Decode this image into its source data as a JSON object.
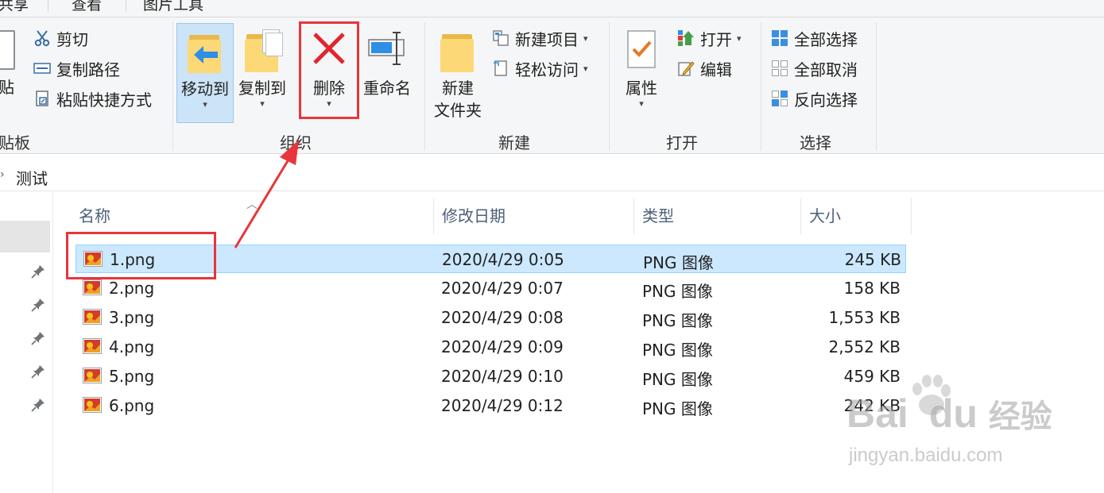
{
  "tabs": [
    "共享",
    "查看",
    "图片工具"
  ],
  "ribbon": {
    "clipboard": {
      "paste_partial": "贴",
      "cut": "剪切",
      "copy_path": "复制路径",
      "paste_shortcut": "粘贴快捷方式",
      "group": "贴板"
    },
    "organize": {
      "move_to": "移动到",
      "copy_to": "复制到",
      "delete": "删除",
      "rename": "重命名",
      "group": "组织"
    },
    "new": {
      "new_item": "新建项目",
      "easy_access": "轻松访问",
      "new_folder_1": "新建",
      "new_folder_2": "文件夹",
      "group": "新建"
    },
    "open": {
      "properties": "属性",
      "open": "打开",
      "edit": "编辑",
      "group": "打开"
    },
    "select": {
      "select_all": "全部选择",
      "select_none": "全部取消",
      "invert": "反向选择",
      "group": "选择"
    }
  },
  "breadcrumb": "测试",
  "columns": {
    "name": "名称",
    "modified": "修改日期",
    "type": "类型",
    "size": "大小"
  },
  "files": [
    {
      "name": "1.png",
      "modified": "2020/4/29 0:05",
      "type": "PNG 图像",
      "size": "245 KB"
    },
    {
      "name": "2.png",
      "modified": "2020/4/29 0:07",
      "type": "PNG 图像",
      "size": "158 KB"
    },
    {
      "name": "3.png",
      "modified": "2020/4/29 0:08",
      "type": "PNG 图像",
      "size": "1,553 KB"
    },
    {
      "name": "4.png",
      "modified": "2020/4/29 0:09",
      "type": "PNG 图像",
      "size": "2,552 KB"
    },
    {
      "name": "5.png",
      "modified": "2020/4/29 0:10",
      "type": "PNG 图像",
      "size": "459 KB"
    },
    {
      "name": "6.png",
      "modified": "2020/4/29 0:12",
      "type": "PNG 图像",
      "size": "242 KB"
    }
  ],
  "watermark": {
    "brand_1": "Bai",
    "brand_2": "du",
    "brand_cn": "经验",
    "url": "jingyan.baidu.com"
  }
}
